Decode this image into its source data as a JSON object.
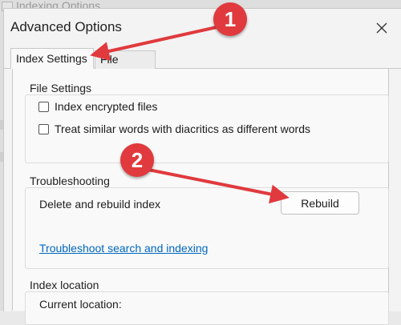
{
  "background_window": {
    "title": "Indexing Options"
  },
  "dialog": {
    "title": "Advanced Options",
    "tabs": [
      {
        "label": "Index Settings",
        "active": true
      },
      {
        "label": "File Types",
        "active": false
      }
    ],
    "file_settings": {
      "label": "File Settings",
      "options": [
        {
          "label": "Index encrypted files",
          "checked": false
        },
        {
          "label": "Treat similar words with diacritics as different words",
          "checked": false
        }
      ]
    },
    "troubleshooting": {
      "label": "Troubleshooting",
      "rebuild_text": "Delete and rebuild index",
      "rebuild_button": "Rebuild",
      "link": "Troubleshoot search and indexing"
    },
    "index_location": {
      "label": "Index location",
      "current_label": "Current location:"
    }
  },
  "annotations": [
    {
      "number": "1",
      "color": "#e03a3e"
    },
    {
      "number": "2",
      "color": "#e03a3e"
    }
  ]
}
